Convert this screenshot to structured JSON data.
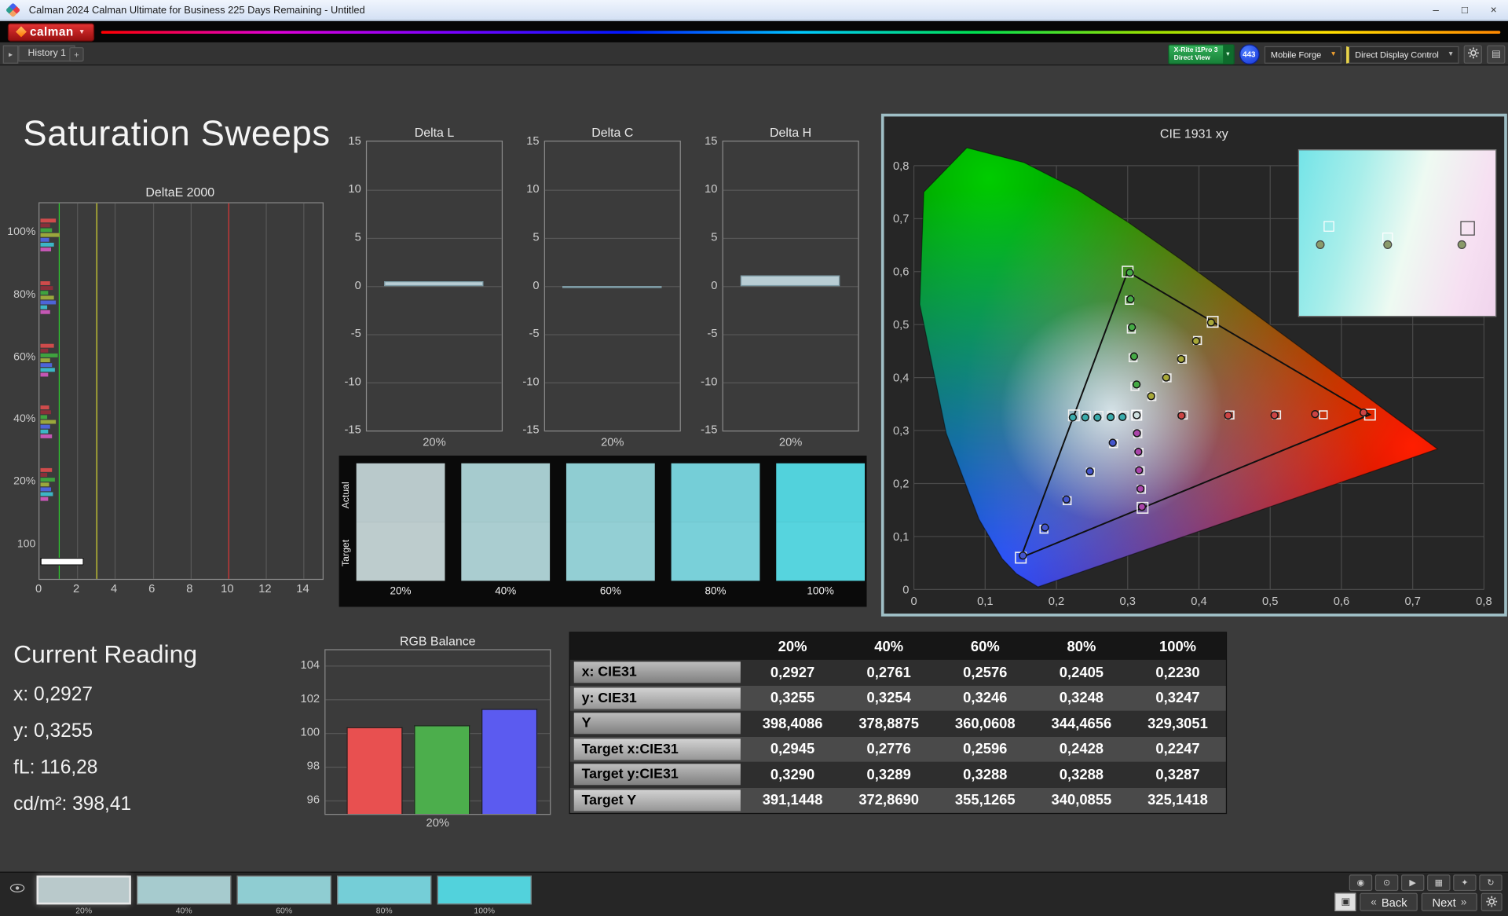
{
  "window": {
    "title": "Calman 2024 Calman Ultimate for Business 225 Days Remaining  - Untitled"
  },
  "brand": {
    "name": "calman"
  },
  "toolbar": {
    "history_tab": "History 1",
    "meter_button": {
      "line1": "X-Rite i1Pro 3",
      "line2": "Direct View"
    },
    "meter_badge": "443",
    "source_button": "Mobile Forge",
    "display_button": "Direct Display Control"
  },
  "page_title": "Saturation Sweeps",
  "levels": [
    "20%",
    "40%",
    "60%",
    "80%",
    "100%"
  ],
  "current_reading": {
    "title": "Current Reading",
    "lines": [
      "x: 0,2927",
      "y: 0,3255",
      "fL: 116,28",
      "cd/m²: 398,41"
    ]
  },
  "results_table": {
    "rows": [
      {
        "label": "x: CIE31",
        "values": [
          "0,2927",
          "0,2761",
          "0,2576",
          "0,2405",
          "0,2230"
        ]
      },
      {
        "label": "y: CIE31",
        "values": [
          "0,3255",
          "0,3254",
          "0,3246",
          "0,3248",
          "0,3247"
        ]
      },
      {
        "label": "Y",
        "values": [
          "398,4086",
          "378,8875",
          "360,0608",
          "344,4656",
          "329,3051"
        ]
      },
      {
        "label": "Target x:CIE31",
        "values": [
          "0,2945",
          "0,2776",
          "0,2596",
          "0,2428",
          "0,2247"
        ]
      },
      {
        "label": "Target y:CIE31",
        "values": [
          "0,3290",
          "0,3289",
          "0,3288",
          "0,3288",
          "0,3287"
        ]
      },
      {
        "label": "Target Y",
        "values": [
          "391,1448",
          "372,8690",
          "355,1265",
          "340,0855",
          "325,1418"
        ]
      }
    ]
  },
  "swatch_panel": {
    "row_labels": [
      "Actual",
      "Target"
    ],
    "items": [
      {
        "actual": "#b9c9cb",
        "target": "#bdcccd"
      },
      {
        "actual": "#a6cbce",
        "target": "#aacdd0"
      },
      {
        "actual": "#8fcdd2",
        "target": "#93cfd4"
      },
      {
        "actual": "#75ced7",
        "target": "#79d0d9"
      },
      {
        "actual": "#52d2dc",
        "target": "#56d4de"
      }
    ]
  },
  "charts": {
    "deltae": {
      "type": "bar",
      "title": "DeltaE 2000",
      "xticks": [
        0,
        2,
        4,
        6,
        8,
        10,
        12,
        14
      ],
      "xmax": 15,
      "ref_lines": [
        {
          "value": 1,
          "color": "#2ecc2e"
        },
        {
          "value": 3,
          "color": "#d8d832"
        },
        {
          "value": 10,
          "color": "#d83232"
        }
      ],
      "bar_colors": [
        "#cf4b4b",
        "#8a2f3a",
        "#3fa23f",
        "#9aa73c",
        "#4d64d8",
        "#3cb6c6",
        "#c457b4"
      ],
      "groups": [
        {
          "label": "100%",
          "values": [
            0.8,
            0.5,
            0.6,
            1.0,
            0.45,
            0.7,
            0.55
          ]
        },
        {
          "label": "80%",
          "values": [
            0.5,
            0.65,
            0.4,
            0.7,
            0.8,
            0.35,
            0.5
          ]
        },
        {
          "label": "60%",
          "values": [
            0.7,
            0.4,
            0.9,
            0.5,
            0.6,
            0.75,
            0.4
          ]
        },
        {
          "label": "40%",
          "values": [
            0.45,
            0.55,
            0.35,
            0.8,
            0.5,
            0.4,
            0.6
          ]
        },
        {
          "label": "20%",
          "values": [
            0.6,
            0.35,
            0.75,
            0.45,
            0.55,
            0.65,
            0.4
          ]
        }
      ],
      "white_group": {
        "label": "100",
        "value": 2.3,
        "color": "#ffffff"
      }
    },
    "delta_l": {
      "type": "bar",
      "title": "Delta L",
      "yticks": [
        15,
        10,
        5,
        0,
        -5,
        -10,
        -15
      ],
      "category": "20%",
      "value": 0.5,
      "bar_color": "#b8cdd4"
    },
    "delta_c": {
      "type": "bar",
      "title": "Delta C",
      "yticks": [
        15,
        10,
        5,
        0,
        -5,
        -10,
        -15
      ],
      "category": "20%",
      "value": -0.15,
      "bar_color": "#b8cdd4"
    },
    "delta_h": {
      "type": "bar",
      "title": "Delta H",
      "yticks": [
        15,
        10,
        5,
        0,
        -5,
        -10,
        -15
      ],
      "category": "20%",
      "value": 1.1,
      "bar_color": "#b8cdd4"
    },
    "rgb": {
      "type": "bar",
      "title": "RGB Balance",
      "yticks": [
        104,
        102,
        100,
        98,
        96
      ],
      "category": "20%",
      "series": [
        {
          "name": "Red",
          "value": 100.35,
          "color": "#e85050"
        },
        {
          "name": "Green",
          "value": 100.45,
          "color": "#4cae4c"
        },
        {
          "name": "Blue",
          "value": 101.45,
          "color": "#5b5bf0"
        }
      ]
    },
    "cie": {
      "type": "scatter",
      "title": "CIE 1931 xy",
      "xticks": [
        "0",
        "0,1",
        "0,2",
        "0,3",
        "0,4",
        "0,5",
        "0,6",
        "0,7",
        "0,8"
      ],
      "yticks": [
        "0",
        "0,1",
        "0,2",
        "0,3",
        "0,4",
        "0,5",
        "0,6",
        "0,7",
        "0,8"
      ],
      "locus": [
        [
          0.1741,
          0.005
        ],
        [
          0.144,
          0.0297
        ],
        [
          0.1241,
          0.0578
        ],
        [
          0.0913,
          0.1327
        ],
        [
          0.0454,
          0.295
        ],
        [
          0.0082,
          0.5384
        ],
        [
          0.0139,
          0.7502
        ],
        [
          0.0743,
          0.8338
        ],
        [
          0.1547,
          0.8059
        ],
        [
          0.2296,
          0.7543
        ],
        [
          0.3016,
          0.6923
        ],
        [
          0.3731,
          0.6245
        ],
        [
          0.4441,
          0.5547
        ],
        [
          0.5125,
          0.4866
        ],
        [
          0.5752,
          0.4242
        ],
        [
          0.627,
          0.3725
        ],
        [
          0.6915,
          0.3083
        ],
        [
          0.7347,
          0.2653
        ]
      ],
      "triangle": [
        [
          0.64,
          0.33
        ],
        [
          0.3,
          0.6
        ],
        [
          0.15,
          0.06
        ]
      ],
      "white_point": [
        0.3127,
        0.329
      ],
      "sweeps": [
        {
          "name": "red",
          "color": "#cc4444",
          "targets": [
            [
              0.3781,
              0.3292
            ],
            [
              0.4436,
              0.3294
            ],
            [
              0.509,
              0.3296
            ],
            [
              0.5745,
              0.3298
            ],
            [
              0.64,
              0.33
            ]
          ],
          "measured": [
            [
              0.3755,
              0.3282
            ],
            [
              0.441,
              0.3285
            ],
            [
              0.506,
              0.329
            ],
            [
              0.563,
              0.331
            ],
            [
              0.631,
              0.334
            ]
          ]
        },
        {
          "name": "green",
          "color": "#44aa44",
          "targets": [
            [
              0.3102,
              0.3832
            ],
            [
              0.3076,
              0.4374
            ],
            [
              0.3051,
              0.4916
            ],
            [
              0.3025,
              0.5458
            ],
            [
              0.3,
              0.6
            ]
          ],
          "measured": [
            [
              0.3125,
              0.387
            ],
            [
              0.309,
              0.44
            ],
            [
              0.306,
              0.495
            ],
            [
              0.304,
              0.548
            ],
            [
              0.303,
              0.598
            ]
          ]
        },
        {
          "name": "blue",
          "color": "#4455cc",
          "targets": [
            [
              0.2802,
              0.2752
            ],
            [
              0.2476,
              0.2214
            ],
            [
              0.2151,
              0.1676
            ],
            [
              0.1825,
              0.1138
            ],
            [
              0.15,
              0.06
            ]
          ],
          "measured": [
            [
              0.279,
              0.277
            ],
            [
              0.247,
              0.223
            ],
            [
              0.214,
              0.17
            ],
            [
              0.184,
              0.117
            ],
            [
              0.153,
              0.064
            ]
          ]
        },
        {
          "name": "cyan",
          "color": "#3aacac",
          "targets": [
            [
              0.2951,
              0.3289
            ],
            [
              0.2775,
              0.3289
            ],
            [
              0.2598,
              0.3288
            ],
            [
              0.2422,
              0.3288
            ],
            [
              0.2246,
              0.3287
            ]
          ],
          "measured": [
            [
              0.2927,
              0.3255
            ],
            [
              0.2761,
              0.3254
            ],
            [
              0.2576,
              0.3246
            ],
            [
              0.2405,
              0.3248
            ],
            [
              0.223,
              0.3247
            ]
          ]
        },
        {
          "name": "magenta",
          "color": "#aa44aa",
          "targets": [
            [
              0.3143,
              0.294
            ],
            [
              0.316,
              0.259
            ],
            [
              0.3176,
              0.2241
            ],
            [
              0.3193,
              0.1891
            ],
            [
              0.3209,
              0.1542
            ]
          ],
          "measured": [
            [
              0.313,
              0.295
            ],
            [
              0.315,
              0.26
            ],
            [
              0.316,
              0.225
            ],
            [
              0.318,
              0.19
            ],
            [
              0.32,
              0.156
            ]
          ]
        },
        {
          "name": "yellow",
          "color": "#a8a838",
          "targets": [
            [
              0.334,
              0.3642
            ],
            [
              0.3553,
              0.3995
            ],
            [
              0.3767,
              0.4347
            ],
            [
              0.398,
              0.47
            ],
            [
              0.4193,
              0.5053
            ]
          ],
          "measured": [
            [
              0.333,
              0.365
            ],
            [
              0.354,
              0.4
            ],
            [
              0.375,
              0.435
            ],
            [
              0.396,
              0.469
            ],
            [
              0.417,
              0.504
            ]
          ]
        }
      ],
      "inset_markers": [
        {
          "sq": [
            15,
            46
          ],
          "dot": [
            11,
            57
          ],
          "big": false
        },
        {
          "sq": [
            45,
            53
          ],
          "dot": [
            45,
            57
          ],
          "big": false
        },
        {
          "sq": [
            86,
            47
          ],
          "dot": [
            83,
            57
          ],
          "big": true
        }
      ]
    }
  },
  "footer": {
    "swatches": [
      "#b9c9cb",
      "#a6cbce",
      "#8fcdd2",
      "#75ced7",
      "#52d2dc"
    ],
    "small_buttons": [
      "◉",
      "⊙",
      "▶",
      "▦",
      "✦",
      "↻"
    ],
    "small_button_names": [
      "eye-button",
      "target-button",
      "play-button",
      "save-button",
      "snapshot-button",
      "refresh-button"
    ],
    "back": "Back",
    "next": "Next"
  },
  "icons": {
    "panel_arrow": "▸",
    "tab_add": "+",
    "dropdown": "▼",
    "minimize": "–",
    "maximize": "□",
    "close": "×",
    "back": "«",
    "next_arrow": "»",
    "white_square": "▣"
  }
}
